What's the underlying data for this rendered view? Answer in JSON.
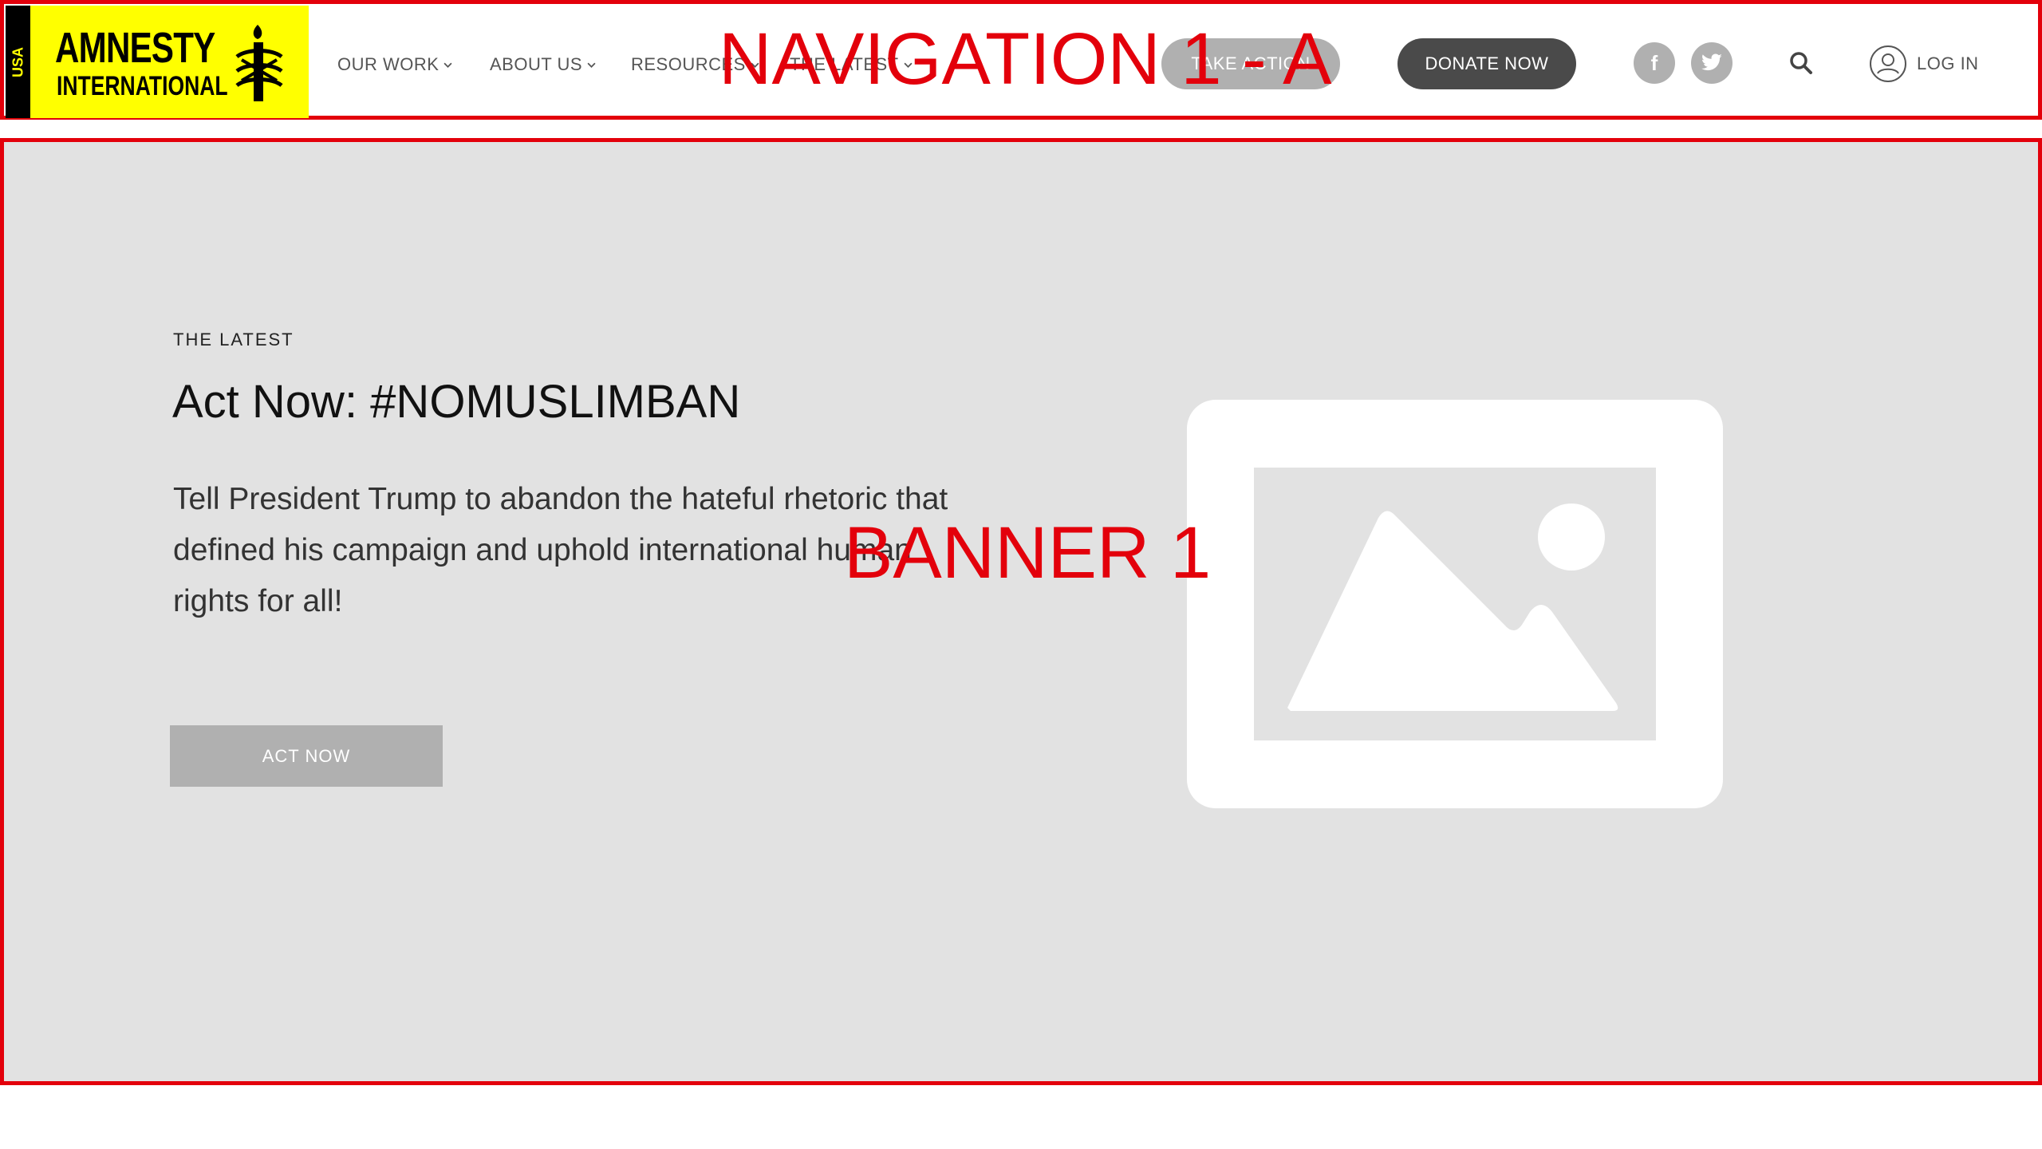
{
  "logo": {
    "strip_text": "USA",
    "line1": "AMNESTY",
    "line2": "INTERNATIONAL",
    "brand_yellow": "#ffff00",
    "icon": "candle-barbed-wire-icon"
  },
  "nav": {
    "items": [
      {
        "label": "OUR WORK"
      },
      {
        "label": "ABOUT US"
      },
      {
        "label": "RESOURCES"
      },
      {
        "label": "THE LATEST"
      }
    ],
    "take_action": "TAKE ACTION",
    "donate": "DONATE NOW",
    "social": [
      {
        "icon": "facebook-icon",
        "glyph": "f"
      },
      {
        "icon": "twitter-icon"
      }
    ],
    "search_icon": "search-icon",
    "login": "LOG IN"
  },
  "annotations": {
    "navigation": "NAVIGATION 1 - A",
    "banner": "BANNER 1",
    "color": "#e3000b"
  },
  "banner": {
    "eyebrow": "THE LATEST",
    "headline": "Act Now: #NOMUSLIMBAN",
    "body": "Tell President Trump to abandon the hateful rhetoric that defined his campaign and uphold international human rights for all!",
    "cta": "ACT NOW",
    "image_icon": "image-placeholder-icon",
    "background": "#e2e2e2"
  }
}
